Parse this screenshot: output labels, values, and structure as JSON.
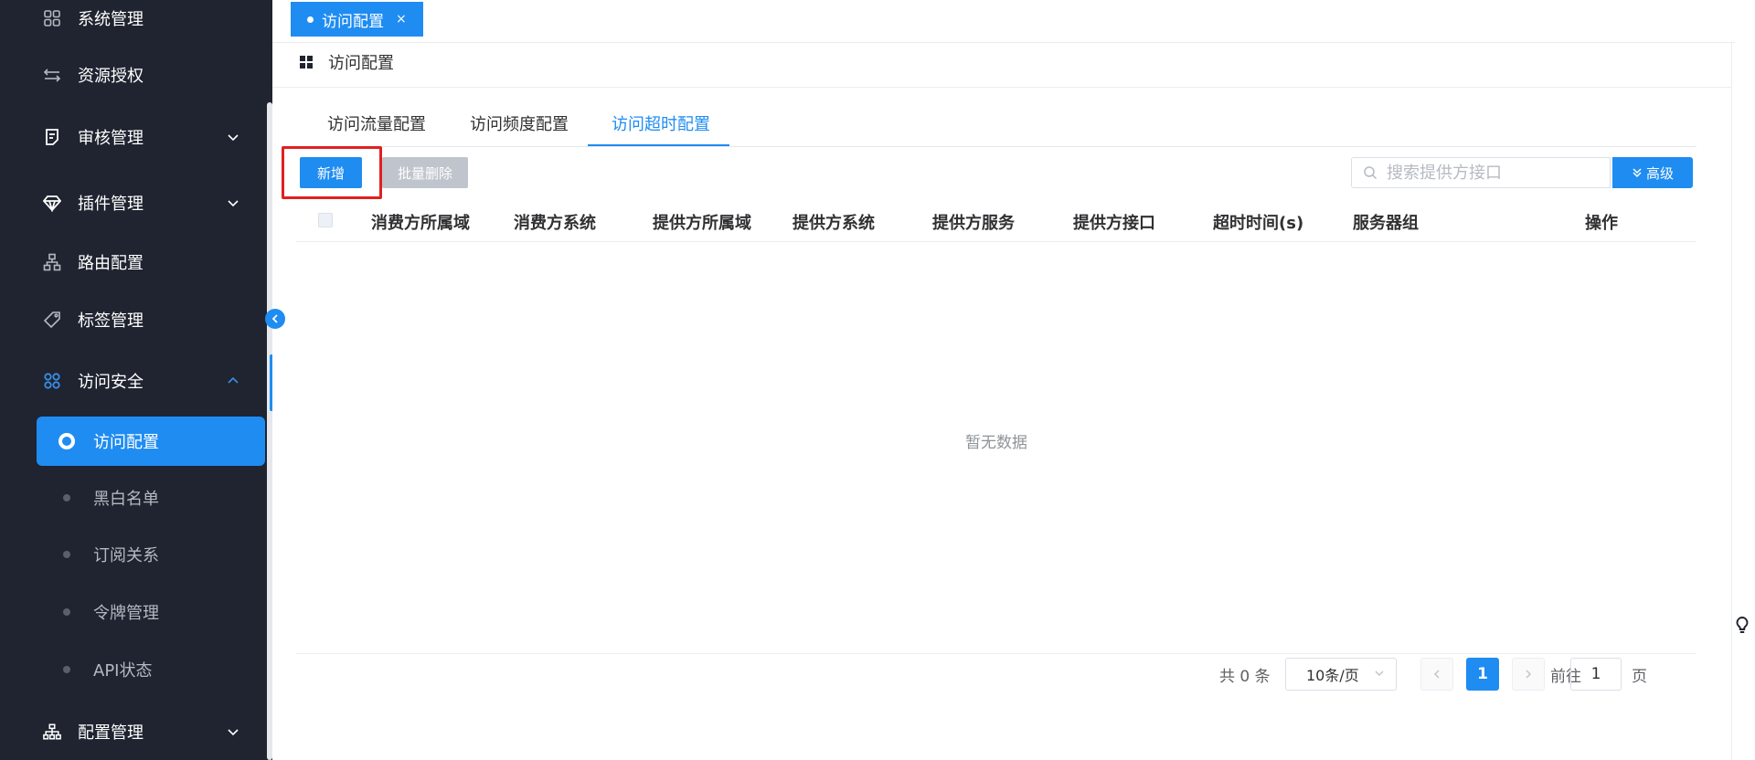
{
  "sidebar": {
    "items": [
      {
        "label": "系统管理",
        "icon": "grid-icon"
      },
      {
        "label": "资源授权",
        "icon": "swap-arrows-icon"
      },
      {
        "label": "审核管理",
        "icon": "audit-icon",
        "expandable": true
      },
      {
        "label": "插件管理",
        "icon": "diamond-icon",
        "expandable": true
      },
      {
        "label": "路由配置",
        "icon": "tree-icon"
      },
      {
        "label": "标签管理",
        "icon": "tag-icon"
      },
      {
        "label": "访问安全",
        "icon": "apps-icon",
        "expandable": true,
        "expanded": true
      },
      {
        "label": "配置管理",
        "icon": "org-chart-icon",
        "expandable": true
      }
    ],
    "sub_items": [
      {
        "label": "访问配置",
        "active": true
      },
      {
        "label": "黑白名单"
      },
      {
        "label": "订阅关系"
      },
      {
        "label": "令牌管理"
      },
      {
        "label": "API状态"
      }
    ]
  },
  "tagbar": {
    "tag_label": "访问配置",
    "close_glyph": "×"
  },
  "breadcrumb": {
    "title": "访问配置"
  },
  "tabs": [
    "访问流量配置",
    "访问频度配置",
    "访问超时配置"
  ],
  "active_tab": 2,
  "toolbar": {
    "add_label": "新增",
    "batch_delete_label": "批量删除",
    "search_placeholder": "搜索提供方接口",
    "advanced_label": "高级"
  },
  "table": {
    "columns": [
      "消费方所属域",
      "消费方系统",
      "提供方所属域",
      "提供方系统",
      "提供方服务",
      "提供方接口",
      "超时时间(s)",
      "服务器组",
      "操作"
    ],
    "rows": [],
    "empty_text": "暂无数据"
  },
  "pagination": {
    "total_text": "共 0 条",
    "page_size": "10条/页",
    "current_page": "1",
    "goto_prefix": "前往",
    "goto_value": "1",
    "goto_suffix": "页"
  },
  "colors": {
    "primary": "#1f8cf2",
    "sidebar_bg": "#1f2430",
    "highlight": "#e02020"
  }
}
